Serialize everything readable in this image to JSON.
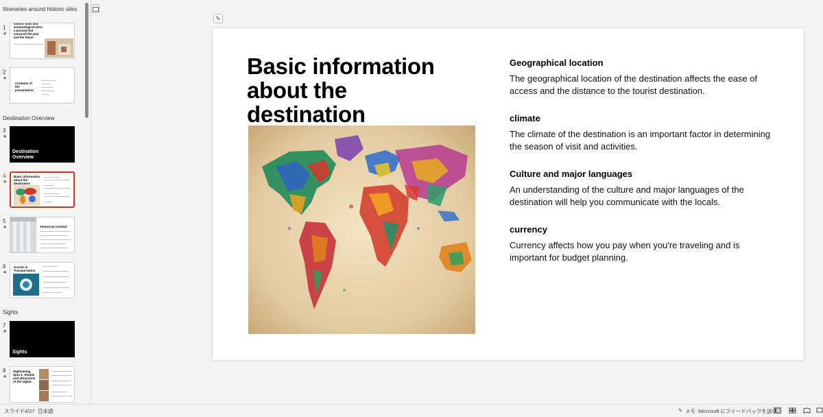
{
  "slide_panel": {
    "sections": [
      {
        "label": "Itineraries around historic sites"
      },
      {
        "label": "Destination Overview"
      },
      {
        "label": "Sights"
      }
    ],
    "slides": [
      {
        "num": "1",
        "title": "historic sites and\narchaeological sites:\na journey that\nconnects the past\nand the future"
      },
      {
        "num": "2",
        "title": "Contents of\nthe\npresentation"
      },
      {
        "num": "3",
        "title": "Destination\nOverview"
      },
      {
        "num": "4",
        "title": "Basic information\nabout the\ndestination"
      },
      {
        "num": "5",
        "title": "Historical Context"
      },
      {
        "num": "6",
        "title": "Access &\nTransportation"
      },
      {
        "num": "7",
        "title": "Sights"
      },
      {
        "num": "8",
        "title": "Sightseeing\nSpot 1: Details\nand attractions\nof the sights"
      }
    ],
    "star": "★",
    "active_slide": 4
  },
  "slide": {
    "title": "Basic information about the destination",
    "topics": [
      {
        "heading": "Geographical location",
        "body": "The geographical location of the destination affects the ease of access and the distance to the tourist destination."
      },
      {
        "heading": "climate",
        "body": "The climate of the destination is an important factor in determining the season of visit and activities."
      },
      {
        "heading": "Culture and major languages",
        "body": "An understanding of the culture and major languages of the destination will help you communicate with the locals."
      },
      {
        "heading": "currency",
        "body": "Currency affects how you pay when you're traveling and is important for budget planning."
      }
    ]
  },
  "status": {
    "slide_count": "スライド4/27",
    "language": "日本語",
    "notes": "メモ",
    "feedback": "Microsoft にフィードバックを送信"
  },
  "colors": {
    "accent": "#c4391d",
    "background": "#f3f3f3"
  },
  "icons": {
    "panel_toggle": "panel-toggle-icon",
    "copilot": "copilot-icon",
    "notes": "notes-icon"
  }
}
